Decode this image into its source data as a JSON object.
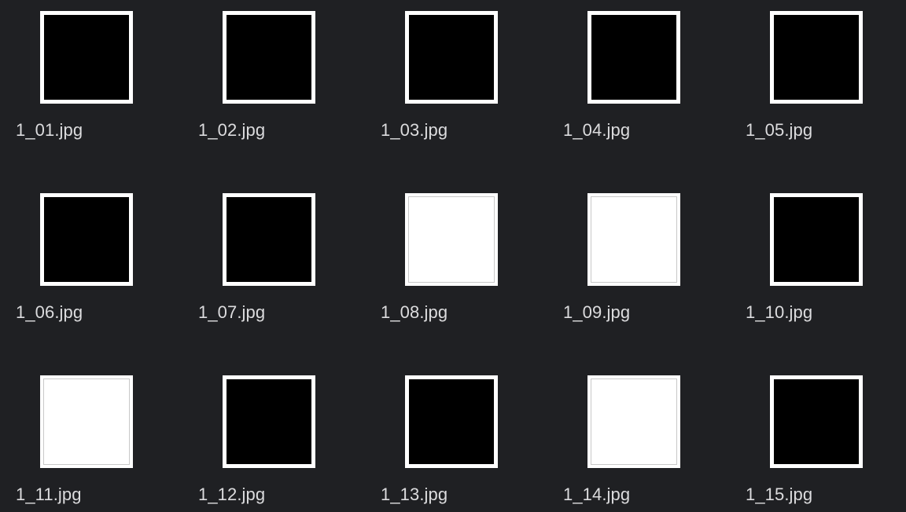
{
  "files": [
    {
      "name": "1_01.jpg",
      "thumb": "dark"
    },
    {
      "name": "1_02.jpg",
      "thumb": "dark"
    },
    {
      "name": "1_03.jpg",
      "thumb": "dark"
    },
    {
      "name": "1_04.jpg",
      "thumb": "dark"
    },
    {
      "name": "1_05.jpg",
      "thumb": "dark"
    },
    {
      "name": "1_06.jpg",
      "thumb": "dark"
    },
    {
      "name": "1_07.jpg",
      "thumb": "dark"
    },
    {
      "name": "1_08.jpg",
      "thumb": "light"
    },
    {
      "name": "1_09.jpg",
      "thumb": "light"
    },
    {
      "name": "1_10.jpg",
      "thumb": "dark"
    },
    {
      "name": "1_11.jpg",
      "thumb": "light"
    },
    {
      "name": "1_12.jpg",
      "thumb": "dark"
    },
    {
      "name": "1_13.jpg",
      "thumb": "dark"
    },
    {
      "name": "1_14.jpg",
      "thumb": "light"
    },
    {
      "name": "1_15.jpg",
      "thumb": "dark"
    }
  ],
  "colors": {
    "background": "#1f2023",
    "label": "#dcdcde",
    "thumb_dark": "#000000",
    "thumb_light": "#ffffff"
  }
}
